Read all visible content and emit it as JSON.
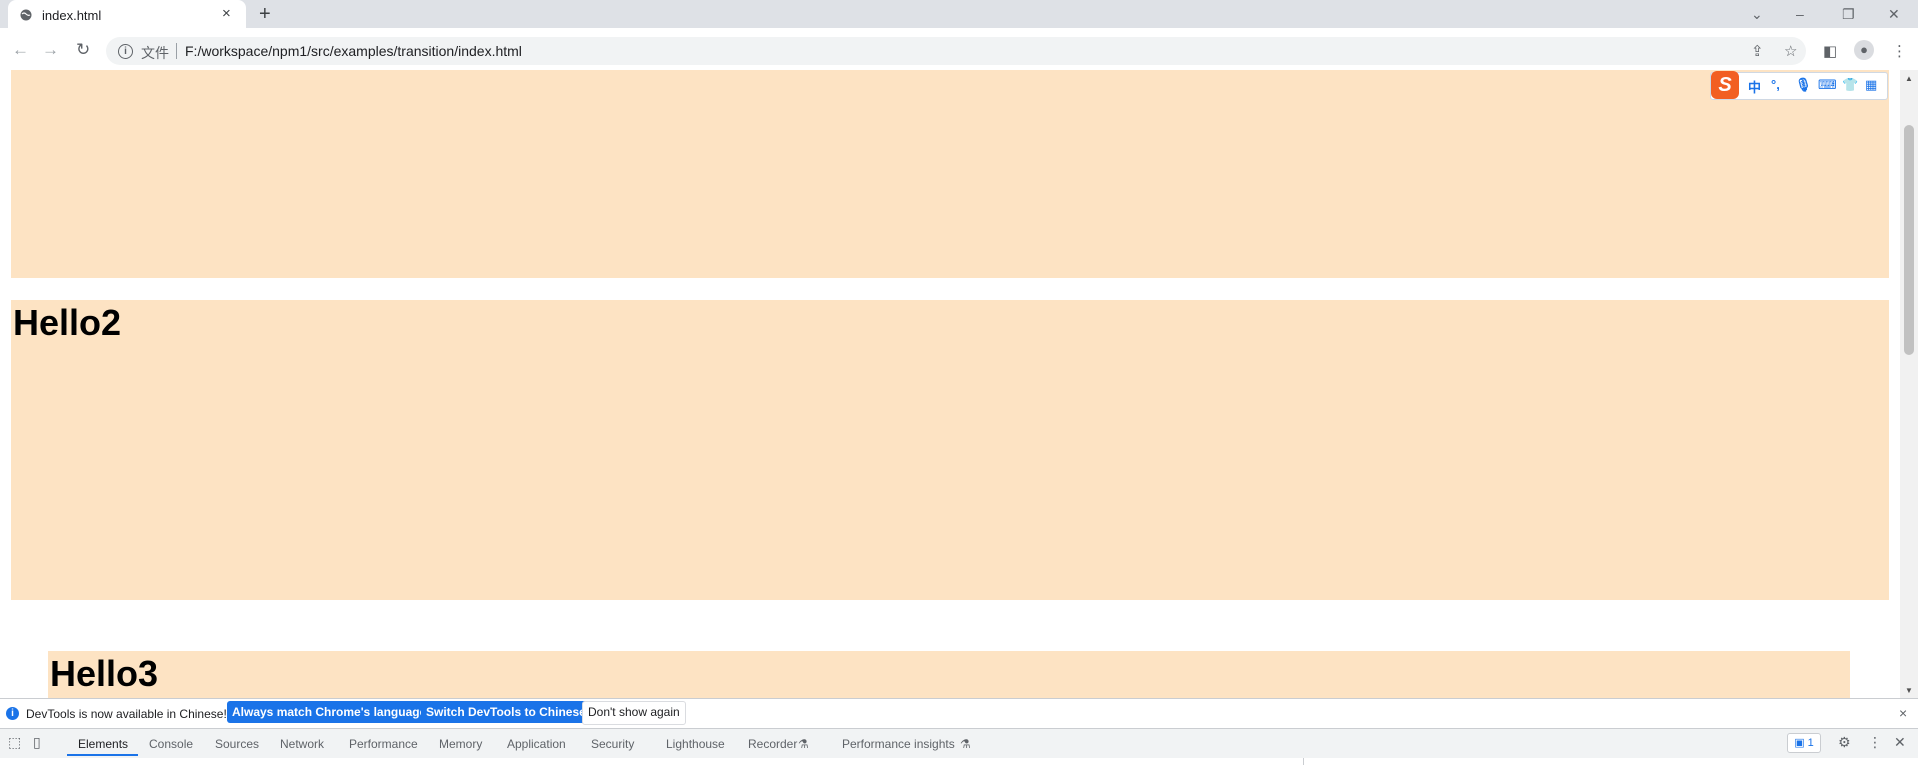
{
  "browser": {
    "tab": {
      "title": "index.html"
    },
    "new_tab_label": "+",
    "window_controls": {
      "dropdown": "⌄",
      "minimize": "–",
      "restore": "❐",
      "close": "✕"
    },
    "address": {
      "scheme_label": "文件",
      "url": "F:/workspace/npm1/src/examples/transition/index.html"
    }
  },
  "page": {
    "background_color": "#fde3c3",
    "boxes": [
      {
        "heading": ""
      },
      {
        "heading": "Hello2"
      },
      {
        "heading": "Hello3"
      }
    ]
  },
  "ime_toolbar": {
    "logo": "S",
    "items": [
      "中",
      "°,",
      "mic-icon",
      "keyboard-icon",
      "shirt-icon",
      "grid-icon"
    ]
  },
  "devtools": {
    "infobar": {
      "message": "DevTools is now available in Chinese!",
      "buttons": [
        "Always match Chrome's language",
        "Switch DevTools to Chinese",
        "Don't show again"
      ]
    },
    "tabs": [
      "Elements",
      "Console",
      "Sources",
      "Network",
      "Performance",
      "Memory",
      "Application",
      "Security",
      "Lighthouse",
      "Recorder",
      "Performance insights"
    ],
    "active_tab": "Elements",
    "issues_count": "1"
  }
}
